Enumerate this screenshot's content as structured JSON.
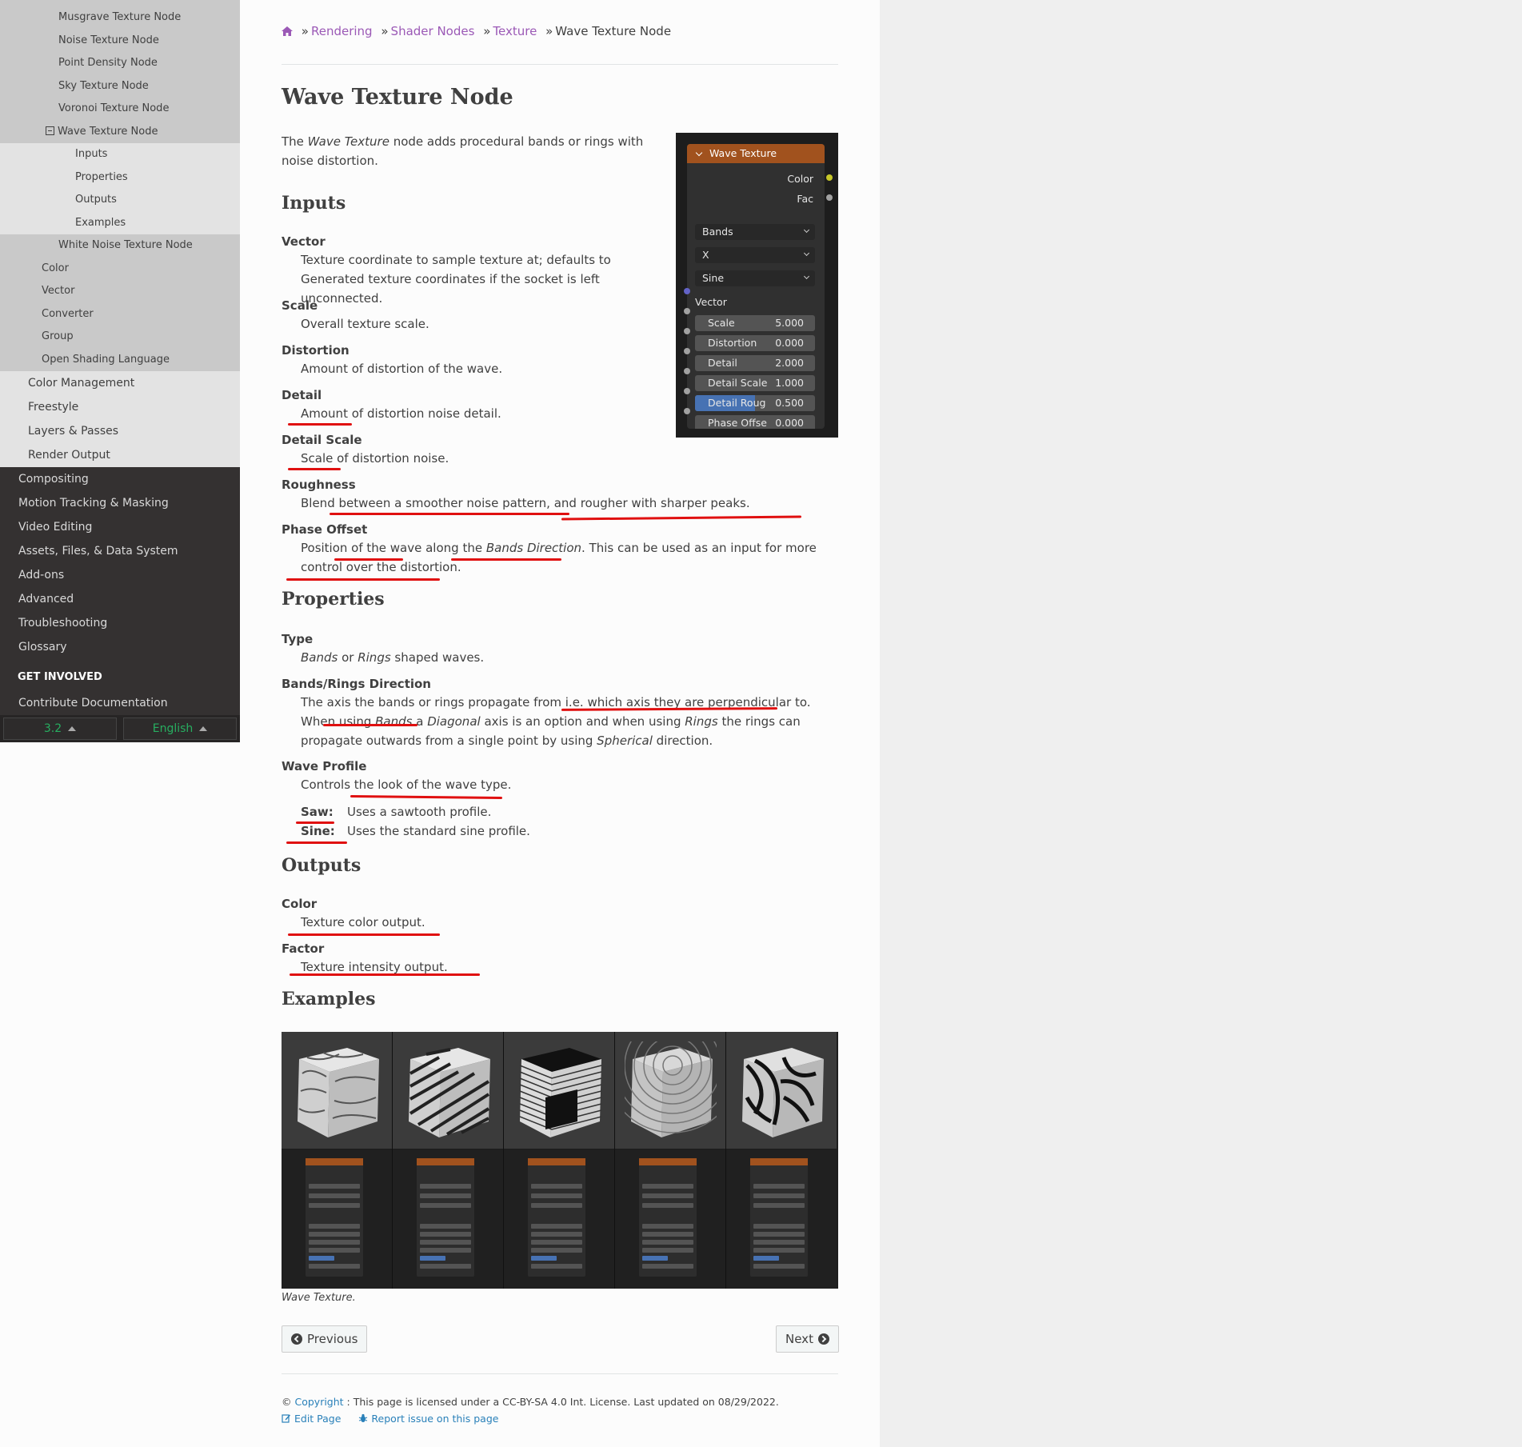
{
  "sidebar": {
    "gray_top": [
      "Musgrave Texture Node",
      "Noise Texture Node",
      "Point Density Node",
      "Sky Texture Node",
      "Voronoi Texture Node"
    ],
    "current": "Wave Texture Node",
    "sub_items": [
      "Inputs",
      "Properties",
      "Outputs",
      "Examples"
    ],
    "gray_after": [
      "White Noise Texture Node"
    ],
    "level2": [
      "Color",
      "Vector",
      "Converter",
      "Group",
      "Open Shading Language"
    ],
    "level1": [
      "Color Management",
      "Freestyle",
      "Layers & Passes",
      "Render Output"
    ],
    "top_level": [
      "Compositing",
      "Motion Tracking & Masking",
      "Video Editing",
      "Assets, Files, & Data System",
      "Add-ons",
      "Advanced",
      "Troubleshooting",
      "Glossary"
    ],
    "get_involved_caption": "GET INVOLVED",
    "contribute": "Contribute Documentation",
    "version": "3.2",
    "language": "English"
  },
  "breadcrumb": {
    "items": [
      "Rendering",
      "Shader Nodes",
      "Texture"
    ],
    "current": "Wave Texture Node",
    "separator": "»"
  },
  "page": {
    "title": "Wave Texture Node",
    "intro_pre": "The ",
    "intro_em": "Wave Texture",
    "intro_post": " node adds procedural bands or rings with noise distortion."
  },
  "inputs": {
    "heading": "Inputs",
    "items": [
      {
        "term": "Vector",
        "def": "Texture coordinate to sample texture at; defaults to Generated texture coordinates if the socket is left unconnected."
      },
      {
        "term": "Scale",
        "def": "Overall texture scale."
      },
      {
        "term": "Distortion",
        "def": "Amount of distortion of the wave."
      },
      {
        "term": "Detail",
        "def": "Amount of distortion noise detail."
      },
      {
        "term": "Detail Scale",
        "def": "Scale of distortion noise."
      },
      {
        "term": "Roughness",
        "def": "Blend between a smoother noise pattern, and rougher with sharper peaks."
      },
      {
        "term": "Phase Offset",
        "def_pre": "Position of the wave along the ",
        "def_em": "Bands Direction",
        "def_post": ". This can be used as an input for more control over the distortion."
      }
    ]
  },
  "properties": {
    "heading": "Properties",
    "type_term": "Type",
    "type_em1": "Bands",
    "type_mid": " or ",
    "type_em2": "Rings",
    "type_post": " shaped waves.",
    "dir_term": "Bands/Rings Direction",
    "dir_1": "The axis the bands or rings propagate from i.e. which axis they are perpendicular to. When using ",
    "dir_em1": "Bands",
    "dir_2": " a ",
    "dir_em2": "Diagonal",
    "dir_3": " axis is an option and when using ",
    "dir_em3": "Rings",
    "dir_4": " the rings can propagate outwards from a single point by using ",
    "dir_em4": "Spherical",
    "dir_5": " direction.",
    "profile_term": "Wave Profile",
    "profile_def": "Controls the look of the wave type.",
    "saw_name": "Saw:",
    "saw_body": "Uses a sawtooth profile.",
    "sine_name": "Sine:",
    "sine_body": "Uses the standard sine profile."
  },
  "outputs": {
    "heading": "Outputs",
    "color_term": "Color",
    "color_def": "Texture color output.",
    "factor_term": "Factor",
    "factor_def": "Texture intensity output."
  },
  "examples": {
    "heading": "Examples",
    "caption": "Wave Texture."
  },
  "node": {
    "title": "Wave Texture",
    "outputs": [
      "Color",
      "Fac"
    ],
    "dropdowns": [
      "Bands",
      "X",
      "Sine"
    ],
    "vector_label": "Vector",
    "sliders": [
      {
        "label": "Scale",
        "value": "5.000"
      },
      {
        "label": "Distortion",
        "value": "0.000"
      },
      {
        "label": "Detail",
        "value": "2.000"
      },
      {
        "label": "Detail Scale",
        "value": "1.000"
      },
      {
        "label": "Detail Roug",
        "value": "0.500",
        "fill_fraction": 0.5
      },
      {
        "label": "Phase Offse",
        "value": "0.000"
      }
    ],
    "colors": {
      "header": "#a1521e",
      "socket_yellow": "#c7c729",
      "socket_gray": "#a1a1a1",
      "socket_blue": "#6363c7",
      "fill_blue": "#4772b3"
    }
  },
  "nav": {
    "previous": "Previous",
    "next": "Next"
  },
  "footer": {
    "copyright_symbol": "©",
    "copyright_link": "Copyright",
    "license_text": ": This page is licensed under a CC-BY-SA 4.0 Int. License. Last updated on 08/29/2022.",
    "edit_page": "Edit Page",
    "report_issue": "Report issue on this page"
  }
}
